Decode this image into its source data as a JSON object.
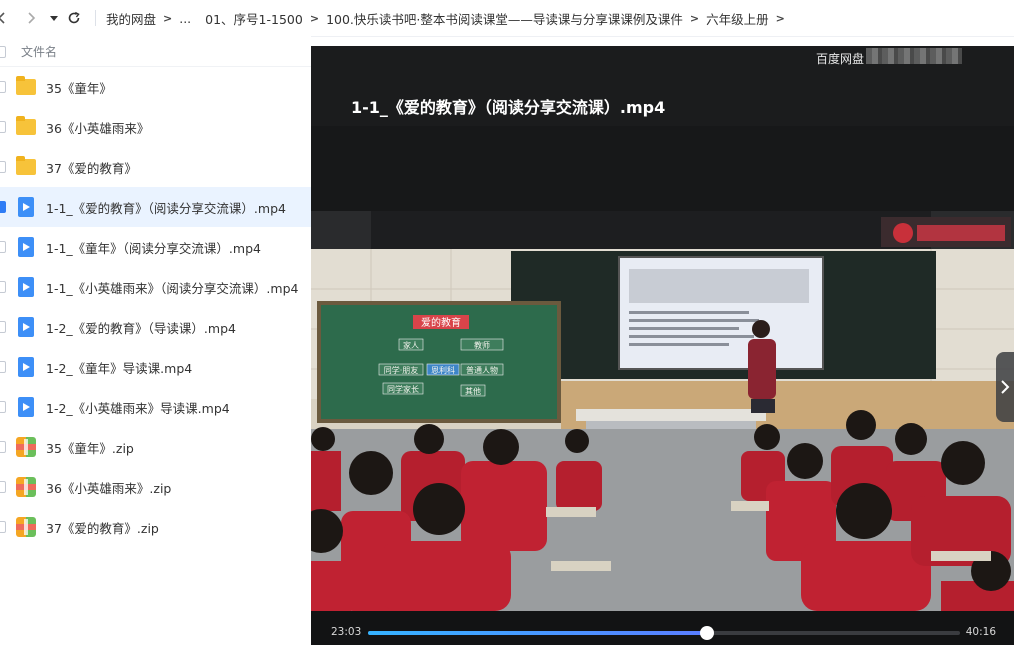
{
  "nav": {
    "back_icon": "chevron-left",
    "forward_icon": "chevron-right",
    "dropdown_icon": "caret-down",
    "refresh_icon": "refresh",
    "breadcrumbs": [
      "我的网盘",
      "...",
      "01、序号1-1500",
      "100.快乐读书吧·整本书阅读课堂——导读课与分享课课例及课件",
      "六年级上册"
    ]
  },
  "filelist": {
    "header": "文件名",
    "items": [
      {
        "name": "35《童年》",
        "type": "folder"
      },
      {
        "name": "36《小英雄雨来》",
        "type": "folder"
      },
      {
        "name": "37《爱的教育》",
        "type": "folder"
      },
      {
        "name": "1-1_《爱的教育》（阅读分享交流课）.mp4",
        "type": "video",
        "selected": true
      },
      {
        "name": "1-1_《童年》（阅读分享交流课）.mp4",
        "type": "video"
      },
      {
        "name": "1-1_《小英雄雨来》（阅读分享交流课）.mp4",
        "type": "video"
      },
      {
        "name": "1-2_《爱的教育》（导读课）.mp4",
        "type": "video"
      },
      {
        "name": "1-2_《童年》导读课.mp4",
        "type": "video"
      },
      {
        "name": "1-2_《小英雄雨来》导读课.mp4",
        "type": "video"
      },
      {
        "name": "35《童年》.zip",
        "type": "zip"
      },
      {
        "name": "36《小英雄雨来》.zip",
        "type": "zip"
      },
      {
        "name": "37《爱的教育》.zip",
        "type": "zip"
      }
    ]
  },
  "player": {
    "watermark": "百度网盘",
    "title": "1-1_《爱的教育》（阅读分享交流课）.mp4",
    "current_time": "23:03",
    "total_time": "40:16",
    "progress": 0.572,
    "next_icon": "chevron-right",
    "frame": {
      "board_heading": "爱的教育",
      "board_cells": [
        "家人",
        "教师",
        "校长",
        "同学·朋友",
        "恩利科",
        "普通人物",
        "同学家长",
        "其他"
      ]
    }
  },
  "colors": {
    "accent": "#2f7cf5",
    "selected_row": "#eaf3ff",
    "folder": "#f7c33a",
    "video_icon": "#3d8ff7",
    "player_bg": "#171819"
  }
}
